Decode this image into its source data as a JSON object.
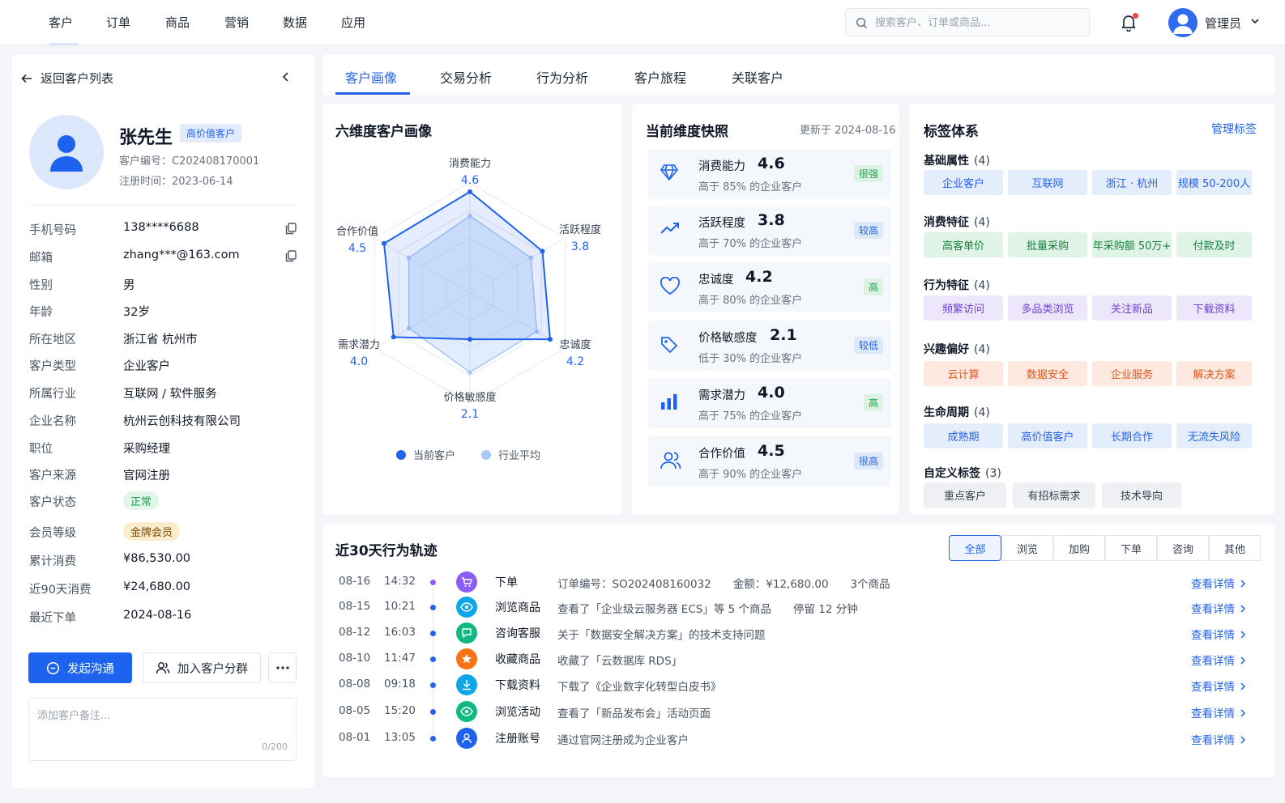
{
  "nav": {
    "items": [
      "客户",
      "订单",
      "商品",
      "营销",
      "数据",
      "应用"
    ],
    "search_placeholder": "搜索客户、订单或商品...",
    "user": "管理员"
  },
  "sidebar": {
    "back": "返回客户列表",
    "name": "张先生",
    "badge": "高价值客户",
    "id_label": "客户编号：C202408170001",
    "reg_label": "注册时间：2023-06-14",
    "fields": [
      {
        "k": "手机号码",
        "v": "138****6688"
      },
      {
        "k": "邮箱",
        "v": "zhang***@163.com"
      },
      {
        "k": "性别",
        "v": "男"
      },
      {
        "k": "年龄",
        "v": "32岁"
      },
      {
        "k": "所在地区",
        "v": "浙江省 杭州市"
      },
      {
        "k": "客户类型",
        "v": "企业客户"
      },
      {
        "k": "所属行业",
        "v": "互联网 / 软件服务"
      },
      {
        "k": "企业名称",
        "v": "杭州云创科技有限公司"
      },
      {
        "k": "职位",
        "v": "采购经理"
      },
      {
        "k": "客户来源",
        "v": "官网注册"
      },
      {
        "k": "客户状态",
        "v": "正常"
      },
      {
        "k": "会员等级",
        "v": "金牌会员"
      },
      {
        "k": "累计消费",
        "v": "¥86,530.00"
      },
      {
        "k": "近90天消费",
        "v": "¥24,680.00"
      },
      {
        "k": "最近下单",
        "v": "2024-08-16"
      }
    ],
    "btn_contact": "发起沟通",
    "btn_group": "加入客户分群",
    "note_placeholder": "添加客户备注...",
    "note_count": "0/200"
  },
  "tabs": [
    "客户画像",
    "交易分析",
    "行为分析",
    "客户旅程",
    "关联客户"
  ],
  "radar": {
    "title": "六维度客户画像",
    "legend": [
      "当前客户",
      "行业平均"
    ],
    "colors": {
      "current": "#1e63ee",
      "avg": "#a9c8f5"
    }
  },
  "chart_data": {
    "type": "radar",
    "categories": [
      "消费能力",
      "活跃程度",
      "忠诚度",
      "价格敏感度",
      "需求潜力",
      "合作价值"
    ],
    "series": [
      {
        "name": "当前客户",
        "values": [
          4.6,
          3.8,
          4.2,
          2.1,
          4.0,
          4.5
        ]
      },
      {
        "name": "行业平均",
        "values": [
          3.5,
          3.2,
          3.5,
          3.6,
          3.2,
          3.2
        ]
      }
    ],
    "value_labels": [
      "4.6",
      "3.8",
      "4.2",
      "2.1",
      "4.0",
      "4.5"
    ],
    "range": [
      0,
      5
    ]
  },
  "snapshot": {
    "title": "当前维度快照",
    "updated": "更新于 2024-08-16",
    "items": [
      {
        "name": "消费能力",
        "score": "4.6",
        "desc": "高于 85% 的企业客户",
        "level": "很强",
        "tone": "g",
        "icon": "diamond-icon"
      },
      {
        "name": "活跃程度",
        "score": "3.8",
        "desc": "高于 70% 的企业客户",
        "level": "较高",
        "tone": "b",
        "icon": "trend-icon"
      },
      {
        "name": "忠诚度",
        "score": "4.2",
        "desc": "高于 80% 的企业客户",
        "level": "高",
        "tone": "g",
        "icon": "heart-icon"
      },
      {
        "name": "价格敏感度",
        "score": "2.1",
        "desc": "低于 30% 的企业客户",
        "level": "较低",
        "tone": "b",
        "icon": "price-tag-icon"
      },
      {
        "name": "需求潜力",
        "score": "4.0",
        "desc": "高于 75% 的企业客户",
        "level": "高",
        "tone": "g",
        "icon": "bar-chart-icon"
      },
      {
        "name": "合作价值",
        "score": "4.5",
        "desc": "高于 90% 的企业客户",
        "level": "很高",
        "tone": "b",
        "icon": "users-icon"
      }
    ]
  },
  "tags": {
    "title": "标签体系",
    "manage": "管理标签",
    "groups": [
      {
        "name": "基础属性",
        "count": "(4)",
        "color": "blue",
        "items": [
          "企业客户",
          "互联网",
          "浙江 · 杭州",
          "规模 50-200人"
        ]
      },
      {
        "name": "消费特征",
        "count": "(4)",
        "color": "green",
        "items": [
          "高客单价",
          "批量采购",
          "年采购额 50万+",
          "付款及时"
        ]
      },
      {
        "name": "行为特征",
        "count": "(4)",
        "color": "purple",
        "items": [
          "频繁访问",
          "多品类浏览",
          "关注新品",
          "下载资料"
        ]
      },
      {
        "name": "兴趣偏好",
        "count": "(4)",
        "color": "orange",
        "items": [
          "云计算",
          "数据安全",
          "企业服务",
          "解决方案"
        ]
      },
      {
        "name": "生命周期",
        "count": "(4)",
        "color": "blue",
        "items": [
          "成熟期",
          "高价值客户",
          "长期合作",
          "无流失风险"
        ]
      },
      {
        "name": "自定义标签",
        "count": "(3)",
        "color": "gray",
        "items": [
          "重点客户",
          "有招标需求",
          "技术导向"
        ]
      }
    ]
  },
  "track": {
    "title": "近30天行为轨迹",
    "filters": [
      "全部",
      "浏览",
      "加购",
      "下单",
      "咨询",
      "其他"
    ],
    "link": "查看详情",
    "rows": [
      {
        "date": "08-16",
        "time": "14:32",
        "type": "下单",
        "desc": "订单编号：SO202408160032　　金额：¥12,680.00　　3个商品",
        "color": "#8b5cf6",
        "icon": "cart-icon"
      },
      {
        "date": "08-15",
        "time": "10:21",
        "type": "浏览商品",
        "desc": "查看了「企业级云服务器 ECS」等 5 个商品　　停留 12 分钟",
        "color": "#0ea5e9",
        "icon": "eye-icon"
      },
      {
        "date": "08-12",
        "time": "16:03",
        "type": "咨询客服",
        "desc": "关于「数据安全解决方案」的技术支持问题",
        "color": "#10b981",
        "icon": "chat-icon"
      },
      {
        "date": "08-10",
        "time": "11:47",
        "type": "收藏商品",
        "desc": "收藏了「云数据库 RDS」",
        "color": "#f97316",
        "icon": "star-icon"
      },
      {
        "date": "08-08",
        "time": "09:18",
        "type": "下载资料",
        "desc": "下载了《企业数字化转型白皮书》",
        "color": "#0ea5e9",
        "icon": "download-icon"
      },
      {
        "date": "08-05",
        "time": "15:20",
        "type": "浏览活动",
        "desc": "查看了「新品发布会」活动页面",
        "color": "#10b981",
        "icon": "eye-icon"
      },
      {
        "date": "08-01",
        "time": "13:05",
        "type": "注册账号",
        "desc": "通过官网注册成为企业客户",
        "color": "#1e63ee",
        "icon": "user-icon"
      }
    ]
  }
}
